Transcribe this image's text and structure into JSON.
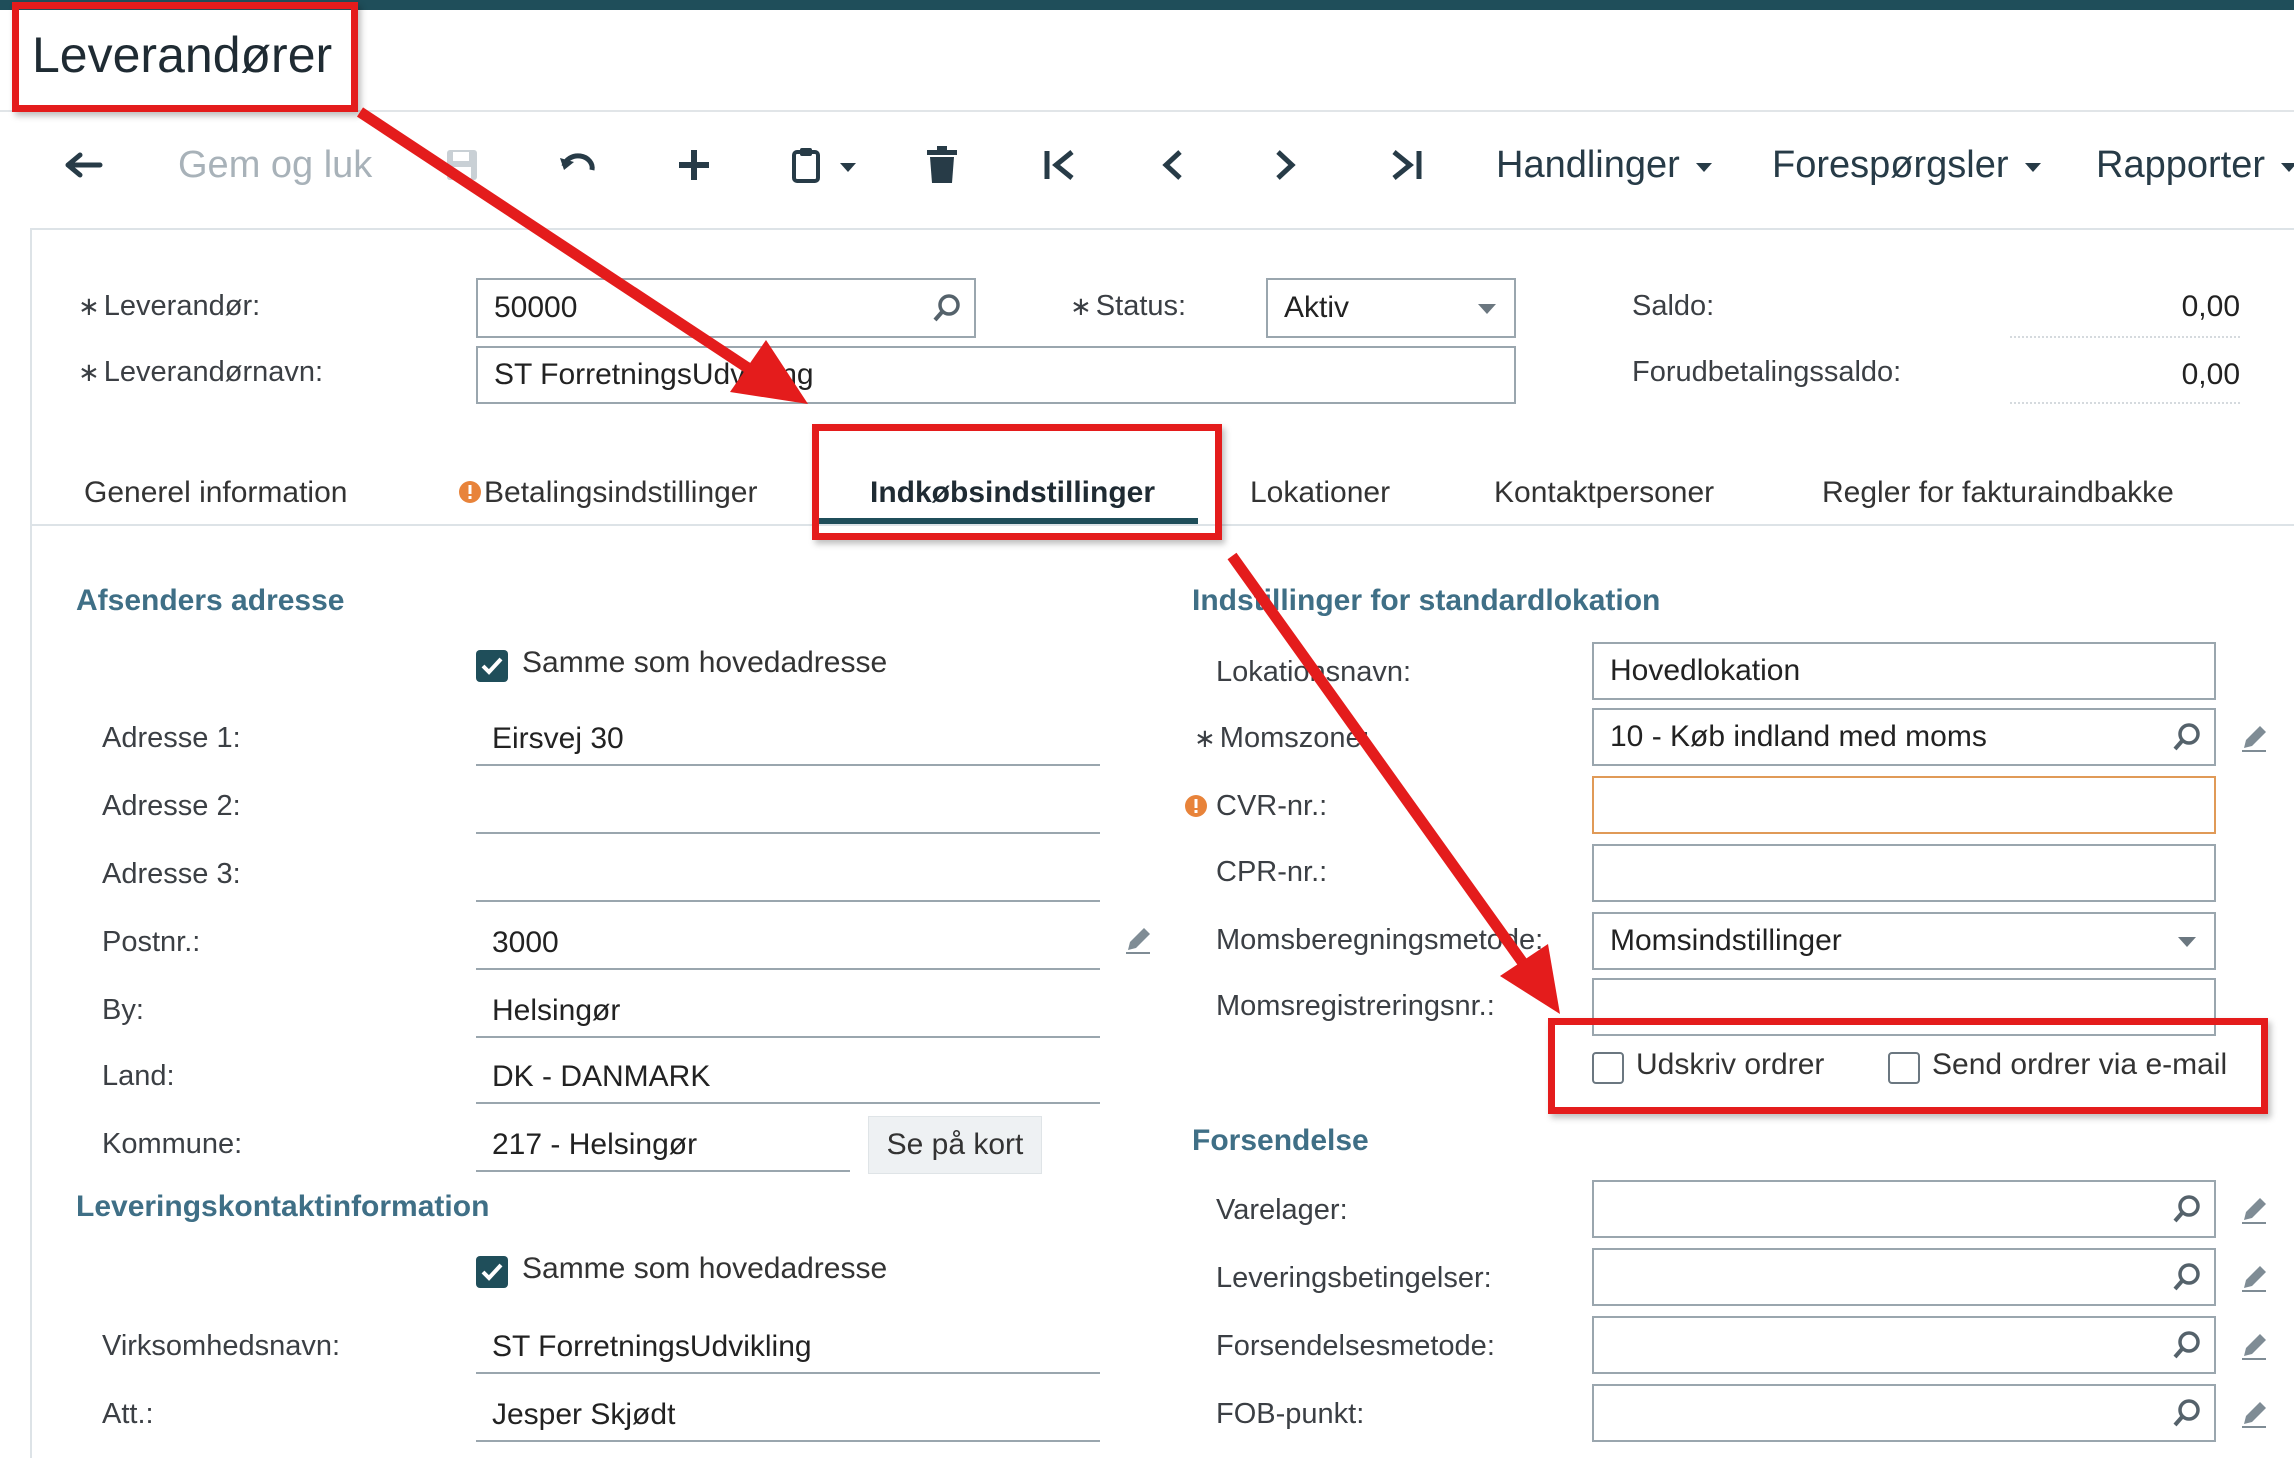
{
  "page": {
    "title": "Leverandører"
  },
  "toolbar": {
    "save_close": "Gem og luk",
    "menus": [
      "Handlinger",
      "Forespørgsler",
      "Rapporter"
    ]
  },
  "header": {
    "vendor_label": "Leverandør:",
    "vendor_value": "50000",
    "vendor_name_label": "Leverandørnavn:",
    "vendor_name_value": "ST ForretningsUdvikling",
    "status_label": "Status:",
    "status_value": "Aktiv",
    "balance_label": "Saldo:",
    "balance_value": "0,00",
    "prepay_label": "Forudbetalingssaldo:",
    "prepay_value": "0,00"
  },
  "tabs": [
    {
      "label": "Generel information"
    },
    {
      "label": "Betalingsindstillinger"
    },
    {
      "label": "Indkøbsindstillinger"
    },
    {
      "label": "Lokationer"
    },
    {
      "label": "Kontaktpersoner"
    },
    {
      "label": "Regler for fakturaindbakke"
    }
  ],
  "sender": {
    "title": "Afsenders adresse",
    "same_label": "Samme som hovedadresse",
    "addr1_label": "Adresse 1:",
    "addr1": "Eirsvej 30",
    "addr2_label": "Adresse 2:",
    "addr2": "",
    "addr3_label": "Adresse 3:",
    "addr3": "",
    "zip_label": "Postnr.:",
    "zip": "3000",
    "city_label": "By:",
    "city": "Helsingør",
    "country_label": "Land:",
    "country": "DK - DANMARK",
    "municipality_label": "Kommune:",
    "municipality": "217 -  Helsingør",
    "map_button": "Se på kort"
  },
  "delivery_contact": {
    "title": "Leveringskontaktinformation",
    "same_label": "Samme som hovedadresse",
    "company_label": "Virksomhedsnavn:",
    "company": "ST ForretningsUdvikling",
    "att_label": "Att.:",
    "att": "Jesper Skjødt"
  },
  "location_settings": {
    "title": "Indstillinger for standardlokation",
    "loc_name_label": "Lokationsnavn:",
    "loc_name": "Hovedlokation",
    "vat_zone_label": "Momszone:",
    "vat_zone": "10 - Køb indland med moms",
    "cvr_label": "CVR-nr.:",
    "cvr": "",
    "cpr_label": "CPR-nr.:",
    "cpr": "",
    "vat_method_label": "Momsberegningsmetode:",
    "vat_method": "Momsindstillinger",
    "vat_reg_label": "Momsregistreringsnr.:",
    "vat_reg": "",
    "print_orders_label": "Udskriv ordrer",
    "email_orders_label": "Send ordrer via e-mail"
  },
  "shipping": {
    "title": "Forsendelse",
    "warehouse_label": "Varelager:",
    "terms_label": "Leveringsbetingelser:",
    "method_label": "Forsendelsesmetode:",
    "fob_label": "FOB-punkt:"
  },
  "colors": {
    "accent": "#1f4e5a",
    "section": "#3f6f86",
    "highlight": "#e41c1c",
    "warning": "#e09a57"
  }
}
